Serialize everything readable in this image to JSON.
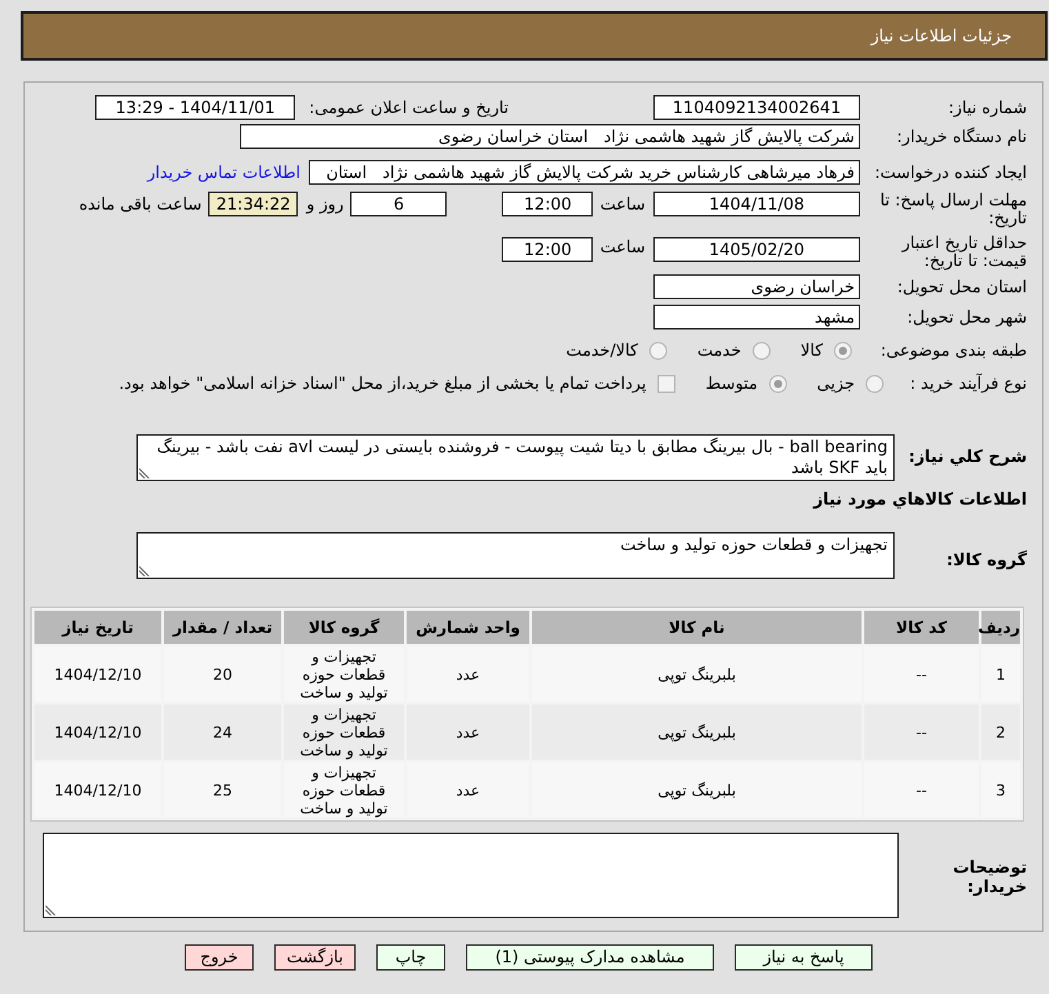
{
  "header": {
    "title": "جزئیات اطلاعات نیاز"
  },
  "need_number": {
    "label": "شماره نیاز:",
    "value": "1104092134002641"
  },
  "announcement": {
    "label": "تاریخ و ساعت اعلان عمومی:",
    "value": "1404/11/01 - 13:29"
  },
  "buyer_org": {
    "label": "نام دستگاه خریدار:",
    "value": "شرکت پالایش گاز شهید هاشمی نژاد   استان خراسان رضوی"
  },
  "requester": {
    "label": "ایجاد کننده درخواست:",
    "value": "فرهاد میرشاهی کارشناس خرید شرکت پالایش گاز شهید هاشمی نژاد   استان",
    "contact_link": "اطلاعات تماس خریدار"
  },
  "reply_deadline": {
    "label": "مهلت ارسال پاسخ: تا تاریخ:",
    "date": "1404/11/08",
    "time_label": "ساعت",
    "time": "12:00",
    "days": "6",
    "days_label": "روز و",
    "remaining": "21:34:22",
    "remaining_label": "ساعت باقی مانده"
  },
  "price_validity": {
    "label": "حداقل تاریخ اعتبار قیمت: تا تاریخ:",
    "date": "1405/02/20",
    "time_label": "ساعت",
    "time": "12:00"
  },
  "delivery_province": {
    "label": "استان محل تحویل:",
    "value": "خراسان رضوی"
  },
  "delivery_city": {
    "label": "شهر محل تحویل:",
    "value": "مشهد"
  },
  "category": {
    "label": "طبقه بندی موضوعی:",
    "options": [
      {
        "label": "کالا",
        "selected": true
      },
      {
        "label": "خدمت",
        "selected": false
      },
      {
        "label": "کالا/خدمت",
        "selected": false
      }
    ]
  },
  "purchase_process": {
    "label": "نوع فرآیند خرید :",
    "options": [
      {
        "label": "جزیی",
        "selected": false
      },
      {
        "label": "متوسط",
        "selected": true
      }
    ],
    "treasury_payment": {
      "checked": false,
      "text": "پرداخت تمام یا بخشی از مبلغ خرید،از محل \"اسناد خزانه اسلامی\" خواهد بود."
    }
  },
  "description": {
    "label": "شرح کلي نیاز:",
    "value": "ball bearing - بال بیرینگ مطابق با دیتا شیت پیوست - فروشنده بایستی در لیست avl نفت باشد - بیرینگ باید SKF باشد"
  },
  "goods_heading": "اطلاعات کالاهاي مورد نیاز",
  "goods_group": {
    "label": "گروه کالا:",
    "value": "تجهیزات و قطعات حوزه تولید و ساخت"
  },
  "table": {
    "columns": [
      "ردیف",
      "کد کالا",
      "نام کالا",
      "واحد شمارش",
      "گروه کالا",
      "تعداد / مقدار",
      "تاریخ نیاز"
    ],
    "rows": [
      [
        "1",
        "--",
        "بلبرینگ توپی",
        "عدد",
        "تجهیزات و قطعات حوزه تولید و ساخت",
        "20",
        "1404/12/10"
      ],
      [
        "2",
        "--",
        "بلبرینگ توپی",
        "عدد",
        "تجهیزات و قطعات حوزه تولید و ساخت",
        "24",
        "1404/12/10"
      ],
      [
        "3",
        "--",
        "بلبرینگ توپی",
        "عدد",
        "تجهیزات و قطعات حوزه تولید و ساخت",
        "25",
        "1404/12/10"
      ]
    ]
  },
  "buyer_notes": {
    "label": "توضیحات خریدار:"
  },
  "buttons": [
    {
      "label": "پاسخ به نیاز",
      "kind": "primary"
    },
    {
      "label": "مشاهده مدارک پیوستی (1)",
      "kind": "primary"
    },
    {
      "label": "چاپ",
      "kind": "primary"
    },
    {
      "label": "بازگشت",
      "kind": "danger"
    },
    {
      "label": "خروج",
      "kind": "danger"
    }
  ]
}
